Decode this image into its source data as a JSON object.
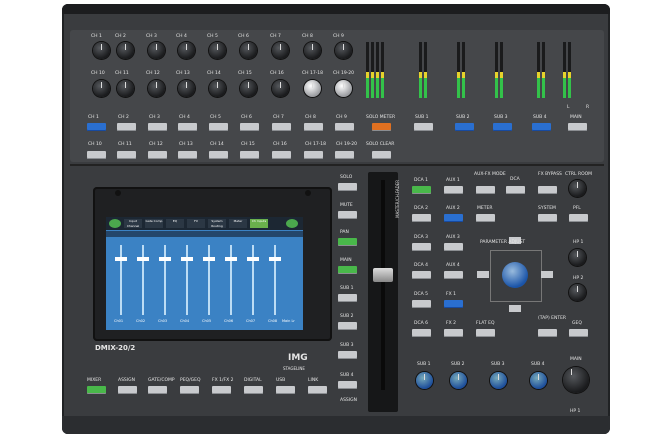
{
  "channels_row1": [
    "CH 1",
    "CH 2",
    "CH 3",
    "CH 4",
    "CH 5",
    "CH 6",
    "CH 7",
    "CH 8",
    "CH 9"
  ],
  "channels_row2": [
    "CH 10",
    "CH 11",
    "CH 12",
    "CH 13",
    "CH 14",
    "CH 15",
    "CH 16",
    "CH 17-18",
    "CH 19-20"
  ],
  "channel_labels_top": [
    "CH 1",
    "CH 2",
    "CH 3",
    "CH 4",
    "CH 5",
    "CH 6",
    "CH 7",
    "CH 8",
    "CH 9"
  ],
  "channel_labels_mid": [
    "CH 10",
    "CH 11",
    "CH 12",
    "CH 13",
    "CH 14",
    "CH 15",
    "CH 16",
    "CH 17-18",
    "CH 19-20"
  ],
  "master_section": {
    "solo_meter": "SOLO METER",
    "solo_clear": "SOLO CLEAR",
    "subs": [
      "SUB 1",
      "SUB 2",
      "SUB 3",
      "SUB 4"
    ],
    "main": "MAIN",
    "lr": [
      "L",
      "R"
    ]
  },
  "screen": {
    "tabs": [
      "Input Channel",
      "Gate Comp",
      "EQ",
      "FX",
      "System Routing",
      "Meter",
      "Ch Inputs"
    ],
    "strip_labels": [
      "Ch01",
      "Ch02",
      "Ch03",
      "Ch04",
      "Ch05",
      "Ch06",
      "Ch07",
      "Ch08"
    ],
    "bottom_label": "Main Lr"
  },
  "model": "DMIX-20/2",
  "brand": "IMG",
  "brand_sub": "STAGELINE",
  "bottom_buttons": [
    "MIXER",
    "ASSIGN",
    "GATE/COMP",
    "PEQ/GEQ",
    "FX 1/FX 2",
    "DIGITAL",
    "USB",
    "LINK"
  ],
  "side_buttons": [
    "SOLO",
    "MUTE",
    "PAN",
    "MAIN",
    "SUB 1",
    "SUB 2",
    "SUB 3",
    "SUB 4"
  ],
  "assign_label": "ASSIGN",
  "right_panel": {
    "col1": [
      "DCA 1",
      "DCA 2",
      "DCA 3",
      "DCA 4",
      "DCA 5",
      "DCA 6"
    ],
    "col2": [
      "AUX 1",
      "AUX 2",
      "AUX 3",
      "AUX 4",
      "FX 1",
      "FX 2"
    ],
    "col3_top": [
      "AUX-FX MODE",
      "METER"
    ],
    "dca_label": "DCA",
    "fx_bypass": "FX BYPASS",
    "system": "SYSTEM",
    "ctrl_room": "CTRL ROOM",
    "pfl": "PFL",
    "parameter_adjust": "PARAMETER ADJUST",
    "flat_eq": "FLAT EQ",
    "tap_enter": "(TAP) ENTER",
    "geq": "GEQ",
    "hp1": "HP 1",
    "hp2": "HP 2",
    "subs_bottom": [
      "SUB 1",
      "SUB 2",
      "SUB 3",
      "SUB 4"
    ],
    "main": "MAIN"
  },
  "fader_label": "MASTER/CH.FADER",
  "hp_bottom": "HP 1"
}
